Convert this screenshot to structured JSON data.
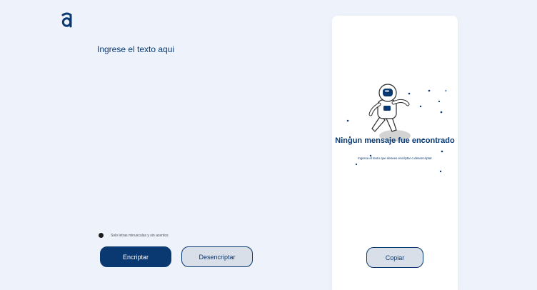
{
  "brand": {
    "logo_icon": "alura-a-logo-icon"
  },
  "input": {
    "placeholder": "Ingrese el texto aqui",
    "value": ""
  },
  "hint": {
    "icon": "info-icon",
    "text": "Solo letras minusculas y sin acentos"
  },
  "buttons": {
    "encrypt": "Encriptar",
    "decrypt": "Desencriptar",
    "copy": "Copiar"
  },
  "output": {
    "illustration": "astronaut-illustration",
    "title": "Ningun mensaje fue encontrado",
    "subtitle": "Ingresa el texto que desees encriptar o desencriptar"
  },
  "colors": {
    "background": "#eef3fb",
    "primary": "#0a3871",
    "secondary_button": "#d8dfe8",
    "panel": "#ffffff"
  }
}
